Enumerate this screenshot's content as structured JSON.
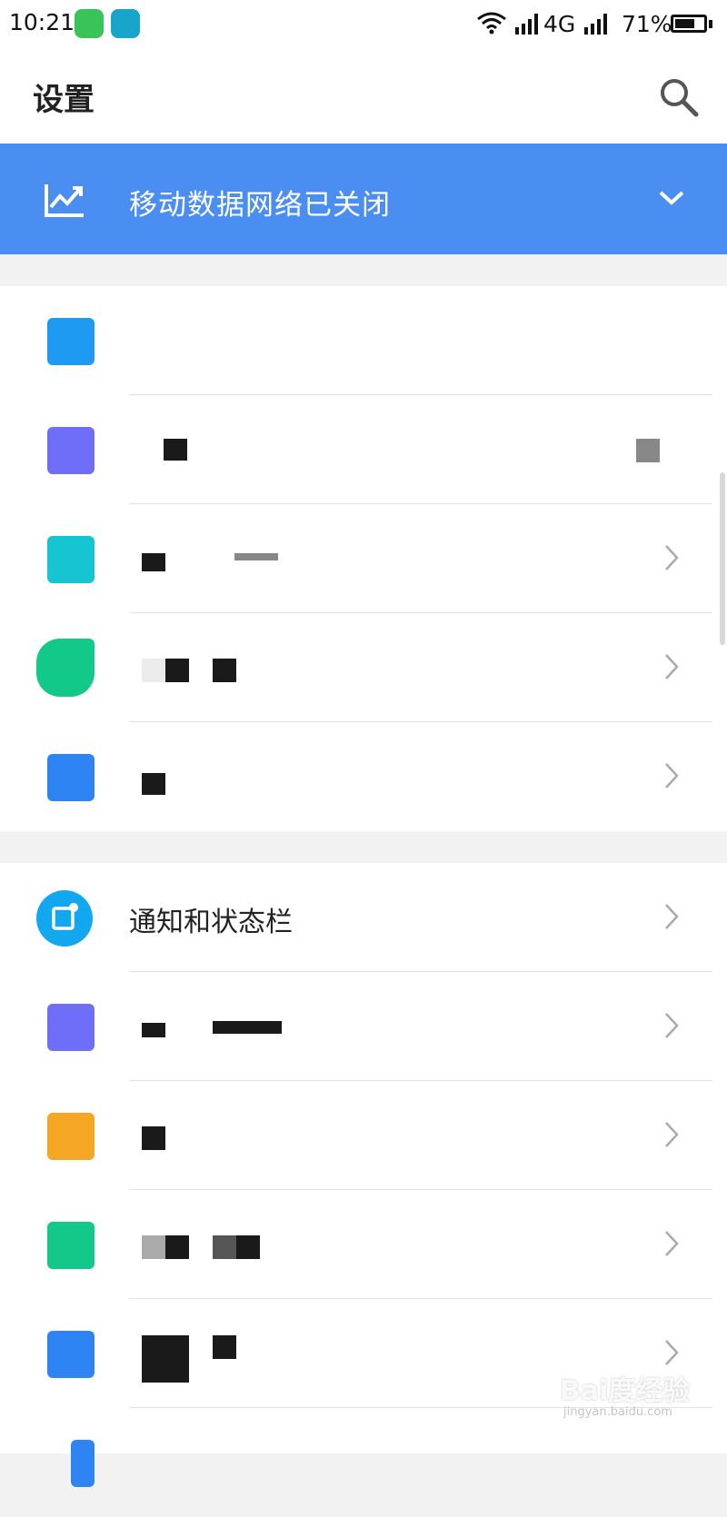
{
  "status_bar": {
    "time": "10:21",
    "network_type": "4G",
    "battery_percent_text": "71%",
    "battery_level": 0.71
  },
  "header": {
    "title": "设置",
    "search_icon": "search-icon"
  },
  "banner": {
    "icon": "trend-chart-icon",
    "text": "移动数据网络已关闭",
    "chevron_icon": "chevron-down-icon",
    "color": "#4a8ef2"
  },
  "settings": {
    "section1": [
      {
        "icon_color": "#1e9af3"
      },
      {
        "icon_color": "#6f6ef8"
      },
      {
        "icon_color": "#17c4d1"
      },
      {
        "icon_color": "#12c98a"
      },
      {
        "icon_color": "#2f84f3"
      }
    ],
    "section2": [
      {
        "label": "通知和状态栏",
        "icon_color": "#12a7ee",
        "icon": "notification-icon"
      },
      {
        "icon_color": "#6f6ef8"
      },
      {
        "icon_color": "#f5a623"
      },
      {
        "icon_color": "#12c98a"
      },
      {
        "icon_color": "#2f84f3"
      }
    ]
  },
  "watermark": {
    "text": "Bai度经验",
    "sub": "jingyan.baidu.com"
  }
}
